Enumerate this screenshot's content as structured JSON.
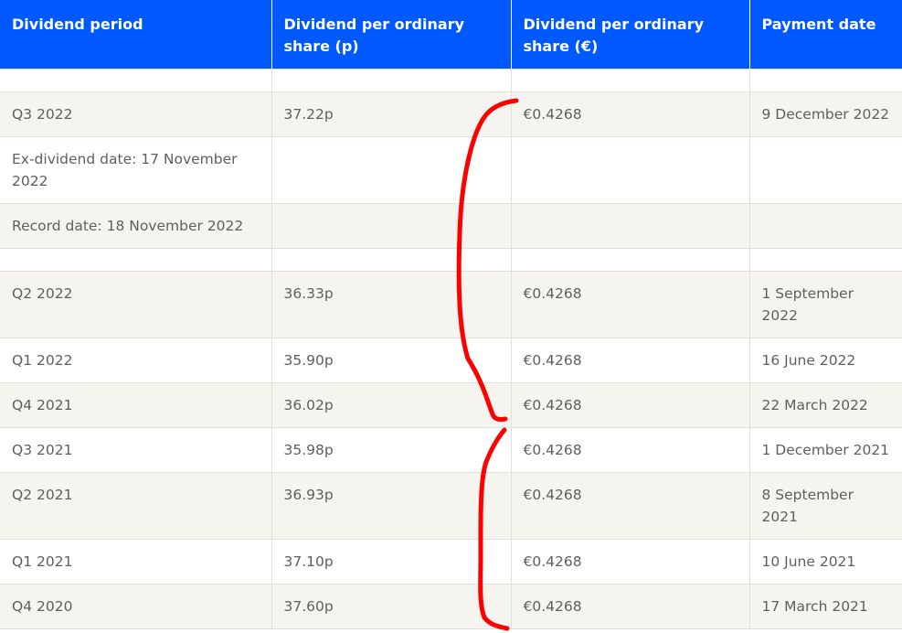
{
  "table": {
    "headers": [
      "Dividend period",
      "Dividend per ordinary share (p)",
      "Dividend per ordinary share (€)",
      "Payment date"
    ],
    "rows": [
      [
        "Q3 2022",
        "37.22p",
        "€0.4268",
        "9 December 2022"
      ],
      [
        "Ex-dividend date: 17 November 2022",
        "",
        "",
        ""
      ],
      [
        "Record date: 18 November 2022",
        "",
        "",
        ""
      ],
      [
        "Q2 2022",
        "36.33p",
        "€0.4268",
        "1 September 2022"
      ],
      [
        "Q1 2022",
        "35.90p",
        "€0.4268",
        "16 June 2022"
      ],
      [
        "Q4 2021",
        "36.02p",
        "€0.4268",
        "22 March 2022"
      ],
      [
        "Q3 2021",
        "35.98p",
        "€0.4268",
        "1 December 2021"
      ],
      [
        "Q2 2021",
        "36.93p",
        "€0.4268",
        "8 September 2021"
      ],
      [
        "Q1 2021",
        "37.10p",
        "€0.4268",
        "10 June 2021"
      ],
      [
        "Q4 2020",
        "37.60p",
        "€0.4268",
        "17 March 2021"
      ]
    ]
  },
  "colors": {
    "header_background": "#0058ff",
    "header_text": "#ffffff",
    "alt_row_background": "#f5f4ef",
    "annotation_stroke": "#ff0000"
  }
}
